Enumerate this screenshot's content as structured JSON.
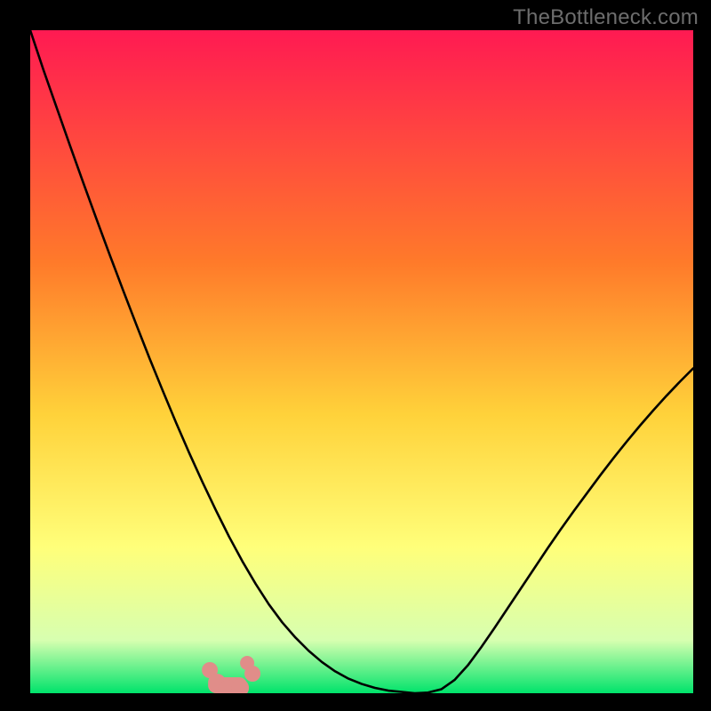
{
  "watermark": "TheBottleneck.com",
  "colors": {
    "frame": "#000000",
    "grad_top": "#ff1a52",
    "grad_mid1": "#ff7a2a",
    "grad_mid2": "#ffd23a",
    "grad_mid3": "#ffff7a",
    "grad_mid4": "#d7ffb0",
    "grad_bottom": "#00e36b",
    "curve": "#000000",
    "blob": "#e08d89"
  },
  "chart_data": {
    "type": "line",
    "title": "",
    "xlabel": "",
    "ylabel": "",
    "xlim": [
      0,
      100
    ],
    "ylim": [
      0,
      100
    ],
    "x": [
      0,
      2,
      4,
      6,
      8,
      10,
      12,
      14,
      16,
      18,
      20,
      22,
      24,
      26,
      28,
      30,
      32,
      34,
      36,
      38,
      40,
      42,
      44,
      46,
      48,
      50,
      52,
      54,
      56,
      58,
      60,
      62,
      64,
      66,
      68,
      70,
      72,
      74,
      76,
      78,
      80,
      82,
      84,
      86,
      88,
      90,
      92,
      94,
      96,
      98,
      100
    ],
    "series": [
      {
        "name": "bottleneck-curve",
        "values": [
          100,
          94,
          88.3,
          82.6,
          77,
          71.5,
          66.1,
          60.8,
          55.6,
          50.5,
          45.6,
          40.8,
          36.2,
          31.8,
          27.6,
          23.6,
          19.9,
          16.5,
          13.4,
          10.7,
          8.4,
          6.4,
          4.7,
          3.3,
          2.2,
          1.4,
          0.8,
          0.4,
          0.2,
          0,
          0.1,
          0.6,
          2,
          4.2,
          6.9,
          9.8,
          12.8,
          15.8,
          18.8,
          21.8,
          24.7,
          27.5,
          30.2,
          32.9,
          35.5,
          38,
          40.4,
          42.7,
          44.9,
          47,
          49
        ]
      }
    ],
    "minimum_marker": {
      "x": 29.5,
      "y": 0
    }
  }
}
